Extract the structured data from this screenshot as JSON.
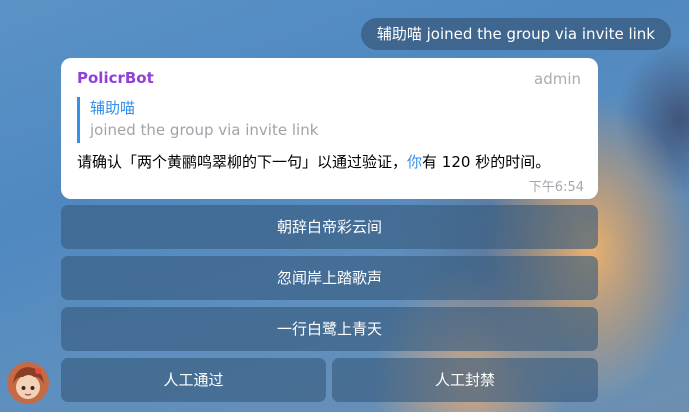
{
  "service_message": {
    "text": "辅助喵 joined the group via invite link"
  },
  "message": {
    "sender": "PolicrBot",
    "admin_tag": "admin",
    "quote": {
      "name": "辅助喵",
      "text": "joined the group via invite link"
    },
    "text_before": "请确认「两个黄鹂鸣翠柳的下一句」以通过验证，",
    "mention": "你",
    "text_after": "有 120 秒的时间。",
    "time": "下午6:54"
  },
  "keyboard": {
    "option_1": "朝辞白帝彩云间",
    "option_2": "忽闻岸上踏歌声",
    "option_3": "一行白鹭上青天",
    "approve": "人工通过",
    "ban": "人工封禁"
  },
  "colors": {
    "sender": "#9140d8",
    "link": "#3390ec",
    "button_bg": "#375a7d"
  }
}
